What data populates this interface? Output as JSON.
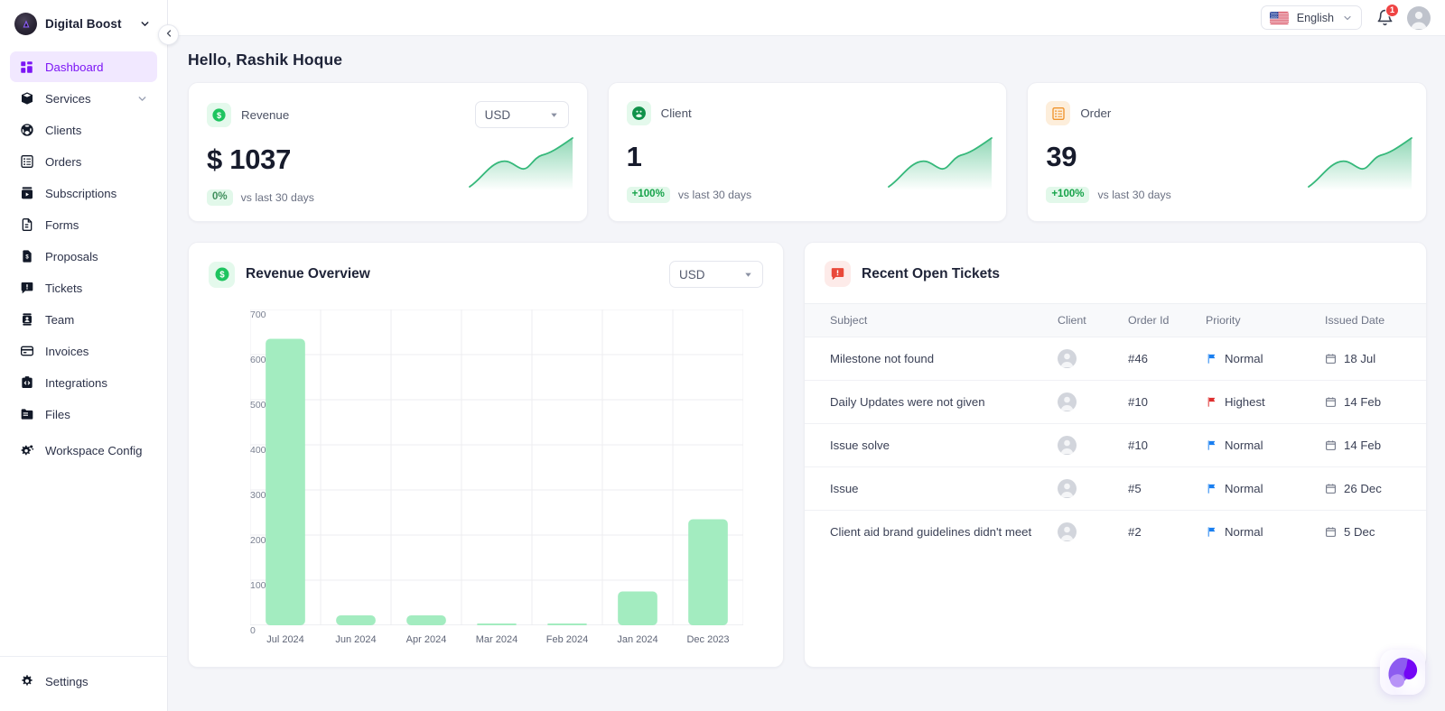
{
  "sidebar": {
    "brand": {
      "name": "Digital Boost",
      "caret_icon": "chevron-down-icon",
      "logo_icon": "digital-boost-logo"
    },
    "items": [
      {
        "label": "Dashboard",
        "icon": "dashboard-grid-icon",
        "active": true
      },
      {
        "label": "Services",
        "icon": "box-icon",
        "caret": true
      },
      {
        "label": "Clients",
        "icon": "clients-icon"
      },
      {
        "label": "Orders",
        "icon": "orders-list-icon"
      },
      {
        "label": "Subscriptions",
        "icon": "subscriptions-icon"
      },
      {
        "label": "Forms",
        "icon": "form-document-icon"
      },
      {
        "label": "Proposals",
        "icon": "proposal-document-icon"
      },
      {
        "label": "Tickets",
        "icon": "ticket-chat-icon"
      },
      {
        "label": "Team",
        "icon": "team-badge-icon"
      },
      {
        "label": "Invoices",
        "icon": "invoice-card-icon"
      },
      {
        "label": "Integrations",
        "icon": "integrations-code-icon"
      },
      {
        "label": "Files",
        "icon": "folder-icon"
      },
      {
        "label": "Workspace Config",
        "icon": "workspace-gear-icon"
      }
    ],
    "bottom": {
      "label": "Settings",
      "icon": "gear-icon"
    },
    "collapse_icon": "chevron-left-icon"
  },
  "topbar": {
    "language": {
      "label": "English",
      "flag_icon": "us-flag-icon",
      "caret_icon": "chevron-down-icon"
    },
    "notifications": {
      "icon": "bell-icon",
      "count": "1"
    },
    "avatar": {
      "icon": "user-avatar-icon"
    }
  },
  "header": {
    "greeting": "Hello, Rashik Hoque"
  },
  "stats": [
    {
      "title": "Revenue",
      "icon": "dollar-circle-icon",
      "icon_tone": "green",
      "value": "$ 1037",
      "delta": "0%",
      "delta_tone": "neutral",
      "delta_note": "vs last 30 days",
      "currency": {
        "value": "USD",
        "caret_icon": "chevron-down-icon"
      }
    },
    {
      "title": "Client",
      "icon": "clients-circle-icon",
      "icon_tone": "green",
      "value": "1",
      "delta": "+100%",
      "delta_tone": "positive",
      "delta_note": "vs last 30 days"
    },
    {
      "title": "Order",
      "icon": "order-list-icon",
      "icon_tone": "orange",
      "value": "39",
      "delta": "+100%",
      "delta_tone": "positive",
      "delta_note": "vs last 30 days"
    }
  ],
  "revenue_overview": {
    "title": "Revenue Overview",
    "icon": "dollar-circle-icon",
    "currency": {
      "value": "USD",
      "caret_icon": "chevron-down-icon"
    }
  },
  "chart_data": {
    "type": "bar",
    "title": "Revenue Overview",
    "xlabel": "",
    "ylabel": "",
    "categories": [
      "Jul 2024",
      "Jun 2024",
      "Apr 2024",
      "Mar 2024",
      "Feb 2024",
      "Jan 2024",
      "Dec 2023"
    ],
    "values": [
      635,
      22,
      22,
      3,
      2,
      75,
      235
    ],
    "ylim": [
      0,
      700
    ],
    "yticks": [
      0,
      100,
      200,
      300,
      400,
      500,
      600,
      700
    ],
    "grid": true,
    "legend": "none",
    "bar_color": "#a3ecc0"
  },
  "tickets": {
    "title": "Recent Open Tickets",
    "icon": "ticket-alert-icon",
    "columns": [
      "Subject",
      "Client",
      "Order Id",
      "Priority",
      "Issued Date"
    ],
    "rows": [
      {
        "subject": "Milestone not found",
        "client_icon": "user-avatar-icon",
        "order_id": "#46",
        "priority": "Normal",
        "priority_color": "#1a7ff0",
        "date": "18 Jul",
        "date_icon": "calendar-icon"
      },
      {
        "subject": "Daily Updates were not given",
        "client_icon": "user-avatar-icon",
        "order_id": "#10",
        "priority": "Highest",
        "priority_color": "#de2f2f",
        "date": "14 Feb",
        "date_icon": "calendar-icon"
      },
      {
        "subject": "Issue solve",
        "client_icon": "user-avatar-icon",
        "order_id": "#10",
        "priority": "Normal",
        "priority_color": "#1a7ff0",
        "date": "14 Feb",
        "date_icon": "calendar-icon"
      },
      {
        "subject": "Issue",
        "client_icon": "user-avatar-icon",
        "order_id": "#5",
        "priority": "Normal",
        "priority_color": "#1a7ff0",
        "date": "26 Dec",
        "date_icon": "calendar-icon"
      },
      {
        "subject": "Client aid brand guidelines didn't meet",
        "client_icon": "user-avatar-icon",
        "order_id": "#2",
        "priority": "Normal",
        "priority_color": "#1a7ff0",
        "date": "5 Dec",
        "date_icon": "calendar-icon"
      }
    ]
  },
  "fab": {
    "icon": "assistant-orb-icon"
  },
  "colors": {
    "accent": "#7c15f5",
    "accent_bg": "#f1e8ff",
    "green": "#22b457",
    "bar": "#a3ecc0",
    "spark": "#35b87a",
    "danger": "#ef4444"
  }
}
